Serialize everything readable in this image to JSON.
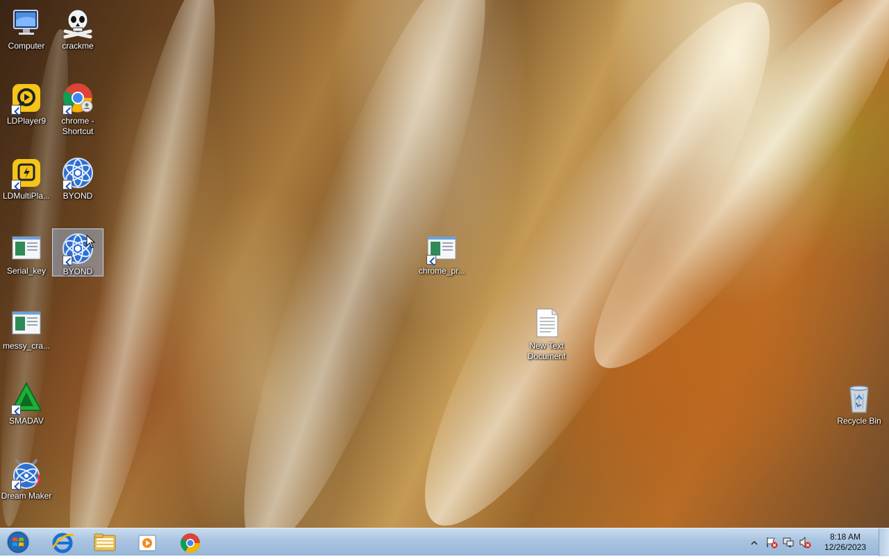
{
  "desktop": {
    "icons": [
      {
        "label": "Computer"
      },
      {
        "label": "crackme"
      },
      {
        "label": "LDPlayer9"
      },
      {
        "label": "chrome -\nShortcut"
      },
      {
        "label": "LDMultiPla..."
      },
      {
        "label": "BYOND"
      },
      {
        "label": "Serial_key"
      },
      {
        "label": "BYOND"
      },
      {
        "label": "messy_cra..."
      },
      {
        "label": "SMADAV"
      },
      {
        "label": "Dream Maker"
      },
      {
        "label": "chrome_pr..."
      },
      {
        "label": "New Text\nDocument"
      },
      {
        "label": "Recycle Bin"
      }
    ]
  },
  "taskbar": {
    "pinned": [
      "start-orb",
      "internet-explorer-icon",
      "file-explorer-icon",
      "media-player-icon",
      "chrome-icon"
    ],
    "clock": {
      "time": "8:18 AM",
      "date": "12/26/2023"
    }
  },
  "colors": {
    "taskbar": "#a9c4e0",
    "selection": "#aac8f0"
  }
}
